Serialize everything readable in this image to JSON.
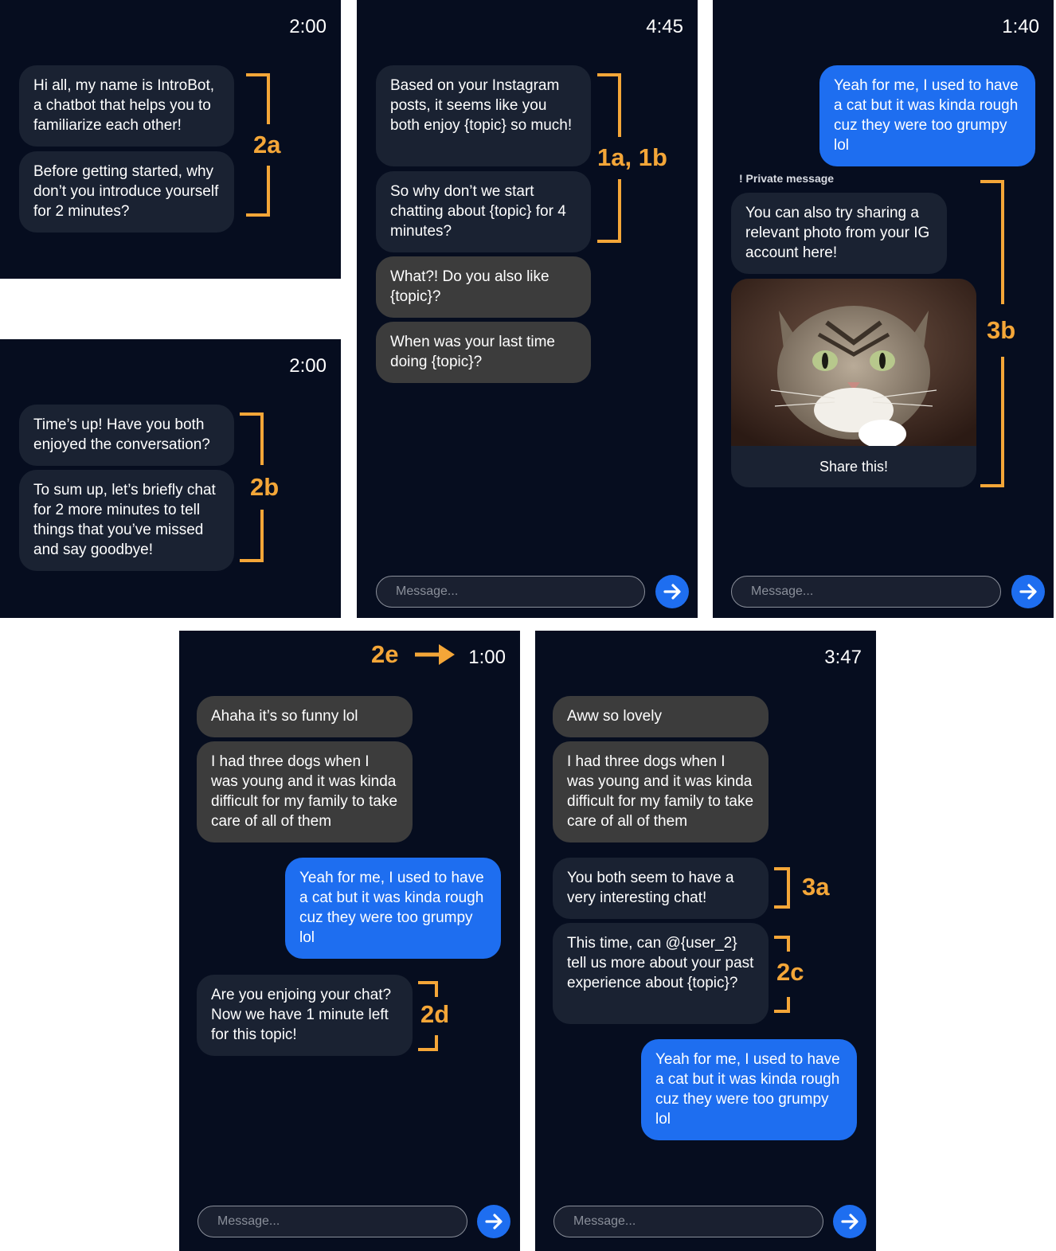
{
  "input_placeholder": "Message...",
  "colors": {
    "background": "#060d1f",
    "bot_bubble": "#1a2232",
    "other_bubble": "#3c3c3c",
    "my_bubble": "#1e6ef0",
    "annotation": "#f4a638"
  },
  "icons": {
    "send": "arrow-right-icon",
    "photo": "cat-photo"
  },
  "p1": {
    "time": "2:00",
    "m1": "Hi all, my name is IntroBot, a chatbot that helps you to familiarize each other!",
    "m2": "Before getting started, why don’t you introduce yourself for 2 minutes?",
    "label": "2a"
  },
  "p2": {
    "time": "4:45",
    "m1": "Based on your Instagram posts, it seems like you both enjoy {topic} so much!",
    "m2": "So why don’t we start chatting about {topic} for 4 minutes?",
    "m3": "What?! Do you also like {topic}?",
    "m4": "When was your last time doing {topic}?",
    "label": "1a, 1b"
  },
  "p3": {
    "time": "1:40",
    "m1": "Yeah for me, I used to have a cat but it was kinda rough cuz they were too grumpy lol",
    "private": "! Private message",
    "m2": "You can also try sharing a relevant photo from your IG account here!",
    "share": "Share this!",
    "label": "3b"
  },
  "p4": {
    "time": "2:00",
    "m1": "Time’s up! Have you both enjoyed the conversation?",
    "m2": "To sum up, let’s briefly chat for 2 more minutes to tell things that you’ve missed and say goodbye!",
    "label": "2b"
  },
  "p5": {
    "time": "1:00",
    "label_top": "2e",
    "m1": "Ahaha it’s so funny lol",
    "m2": "I had three dogs when I was young and it was kinda difficult for my family to take care of all of them",
    "m3": "Yeah for me, I used to have a cat but it was kinda rough cuz they were too grumpy lol",
    "m4": "Are you enjoing your chat? Now we have 1 minute left for this topic!",
    "label": "2d"
  },
  "p6": {
    "time": "3:47",
    "m1": "Aww so lovely",
    "m2": "I had three dogs when I was young and it was kinda difficult for my family to take care of all of them",
    "m3": "You both seem to have a very interesting chat!",
    "m4": "This time, can @{user_2} tell us more about your past experience about {topic}?",
    "m5": "Yeah for me, I used to have a cat but it was kinda rough cuz they were too grumpy lol",
    "label3a": "3a",
    "label2c": "2c"
  }
}
